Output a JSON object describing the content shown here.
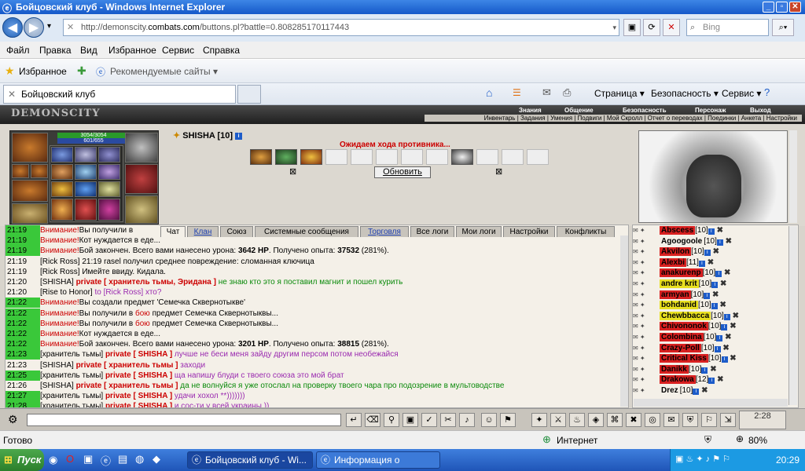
{
  "window": {
    "title": "Бойцовский клуб - Windows Internet Explorer"
  },
  "address": {
    "url_pre": "http://demonscity.",
    "url_dom": "combats.com",
    "url_post": "/buttons.pl?battle=0.808285170117443",
    "search_placeholder": "Bing"
  },
  "menu": [
    "Файл",
    "Правка",
    "Вид",
    "Избранное",
    "Сервис",
    "Справка"
  ],
  "favbar": {
    "favorites": "Избранное",
    "suggested": "Рекомендуемые сайты ▾"
  },
  "tab": {
    "title": "Бойцовский клуб"
  },
  "cmdbar": {
    "page": "Страница ▾",
    "safety": "Безопасность ▾",
    "tools": "Сервис ▾"
  },
  "game": {
    "logo": "DEMONSCITY",
    "topmenu": [
      "Знания",
      "Общение",
      "Безопасность",
      "Персонаж",
      "Выход"
    ],
    "submenu": "Инвентарь | Задания | Умения | Подвиги | Мой Скролл | Отчет о переводах | Поединки | Анкета | Настройки",
    "hp": "3054/3054",
    "mp": "601/655",
    "player": "SHISHA [10]",
    "waiting": "Ожидаем хода противника...",
    "refresh": "Обновить",
    "chat_tabs": [
      "Чат",
      "Клан",
      "Союз",
      "Системные сообщения",
      "Торговля",
      "Все логи",
      "Мои логи",
      "Настройки",
      "Конфликты"
    ],
    "chat": [
      {
        "t": "21:19",
        "g": true,
        "parts": [
          [
            "warn",
            "Внимание!"
          ],
          [
            "",
            "Вы получили в"
          ]
        ]
      },
      {
        "t": "21:19",
        "g": true,
        "parts": [
          [
            "warn",
            "Внимание!"
          ],
          [
            "",
            "Кот нуждается в еде..."
          ]
        ]
      },
      {
        "t": "21:19",
        "g": true,
        "parts": [
          [
            "warn",
            "Внимание!"
          ],
          [
            "",
            "Бой закончен. Всего вами нанесено урона: "
          ],
          [
            "b",
            "3642 HP"
          ],
          [
            "",
            ". Получено опыта: "
          ],
          [
            "b",
            "37532"
          ],
          [
            "",
            " (281%)."
          ]
        ]
      },
      {
        "t": "21:19",
        "g": false,
        "parts": [
          [
            "nick",
            "[Rick Ross]"
          ],
          [
            "",
            " 21:19 rasel получил среднее повреждение: сломанная ключица"
          ]
        ]
      },
      {
        "t": "21:19",
        "g": false,
        "parts": [
          [
            "nick",
            "[Rick Ross]"
          ],
          [
            "",
            " Имейте ввиду. Кидала."
          ]
        ]
      },
      {
        "t": "21:20",
        "g": false,
        "parts": [
          [
            "nick",
            "[SHISHA]"
          ],
          [
            "priv",
            " private [ хранитель тьмы, Эридана ]"
          ],
          [
            "gm",
            " не знаю кто это я поставил магнит и пошел курить"
          ]
        ]
      },
      {
        "t": "21:20",
        "g": false,
        "parts": [
          [
            "nick",
            "[Rise to Honor]"
          ],
          [
            "pm",
            " to [Rick Ross] хто?"
          ]
        ]
      },
      {
        "t": "21:22",
        "g": true,
        "parts": [
          [
            "warn",
            "Внимание!"
          ],
          [
            "",
            "Вы создали предмет 'Семечка Сквернотыкве'"
          ]
        ]
      },
      {
        "t": "21:22",
        "g": true,
        "parts": [
          [
            "warn",
            "Внимание!"
          ],
          [
            "",
            "Вы получили в "
          ],
          [
            "warn",
            "бою"
          ],
          [
            "",
            " предмет Семечка Сквернотыквы..."
          ]
        ]
      },
      {
        "t": "21:22",
        "g": true,
        "parts": [
          [
            "warn",
            "Внимание!"
          ],
          [
            "",
            "Вы получили в "
          ],
          [
            "warn",
            "бою"
          ],
          [
            "",
            " предмет Семечка Сквернотыквы..."
          ]
        ]
      },
      {
        "t": "21:22",
        "g": true,
        "parts": [
          [
            "warn",
            "Внимание!"
          ],
          [
            "",
            "Кот нуждается в еде..."
          ]
        ]
      },
      {
        "t": "21:22",
        "g": true,
        "parts": [
          [
            "warn",
            "Внимание!"
          ],
          [
            "",
            "Бой закончен. Всего вами нанесено урона: "
          ],
          [
            "b",
            "3201 HP"
          ],
          [
            "",
            ". Получено опыта: "
          ],
          [
            "b",
            "38815"
          ],
          [
            "",
            " (281%)."
          ]
        ]
      },
      {
        "t": "21:23",
        "g": true,
        "parts": [
          [
            "nick",
            "[хранитель тьмы]"
          ],
          [
            "priv",
            " private [ SHISHA ]"
          ],
          [
            "pm",
            " лучше не беси меня зайду другим персом потом необежайся"
          ]
        ]
      },
      {
        "t": "21:23",
        "g": false,
        "parts": [
          [
            "nick",
            "[SHISHA]"
          ],
          [
            "priv",
            " private [ хранитель тьмы ]"
          ],
          [
            "pm",
            " заходи"
          ]
        ]
      },
      {
        "t": "21:25",
        "g": true,
        "parts": [
          [
            "nick",
            "[хранитель тьмы]"
          ],
          [
            "priv",
            " private [ SHISHA ]"
          ],
          [
            "pm",
            " ща напишу блуди с твоего союза это мой брат"
          ]
        ]
      },
      {
        "t": "21:26",
        "g": false,
        "parts": [
          [
            "nick",
            "[SHISHA]"
          ],
          [
            "priv",
            " private [ хранитель тьмы ]"
          ],
          [
            "gm",
            " да не волнуйся я уже отослал на проверку твоего чара про подозрение в мультоводстве"
          ]
        ]
      },
      {
        "t": "21:27",
        "g": true,
        "parts": [
          [
            "nick",
            "[хранитель тьмы]"
          ],
          [
            "priv",
            " private [ SHISHA ]"
          ],
          [
            "pm",
            " удачи хохол **)))))))"
          ]
        ]
      },
      {
        "t": "21:28",
        "g": true,
        "parts": [
          [
            "nick",
            "[хранитель тьмы]"
          ],
          [
            "priv",
            " private [ SHISHA ]"
          ],
          [
            "pm",
            " и сос-ти у всей украины ))"
          ]
        ]
      }
    ],
    "users": [
      {
        "n": "Abscess",
        "l": "[10]",
        "c": "red"
      },
      {
        "n": "Agoogoole",
        "l": "[10]",
        "c": ""
      },
      {
        "n": "Akvilon",
        "l": "[10]",
        "c": "red"
      },
      {
        "n": "Alexbi",
        "l": "[11]",
        "c": "red"
      },
      {
        "n": "anakurenp",
        "l": "[10]",
        "c": "red"
      },
      {
        "n": "andre krit",
        "l": "[10]",
        "c": "yel"
      },
      {
        "n": "armyan",
        "l": "[10]",
        "c": "red"
      },
      {
        "n": "bohdanid",
        "l": "[10]",
        "c": "yel"
      },
      {
        "n": "Chewbbacca",
        "l": "[10]",
        "c": "yel"
      },
      {
        "n": "Chivononok",
        "l": "[10]",
        "c": "red"
      },
      {
        "n": "Colombina",
        "l": "[10]",
        "c": "red"
      },
      {
        "n": "Crazy-Poll",
        "l": "[10]",
        "c": "red"
      },
      {
        "n": "Critical Kiss",
        "l": "[10]",
        "c": "red"
      },
      {
        "n": "Danikk",
        "l": "[10]",
        "c": "red"
      },
      {
        "n": "Drakowa",
        "l": "[12]",
        "c": "red"
      },
      {
        "n": "Drez",
        "l": "[10]",
        "c": ""
      }
    ],
    "clock": "2:28"
  },
  "status": {
    "ready": "Готово",
    "zone": "Интернет",
    "zoom": "80%"
  },
  "taskbar": {
    "start": "Пуск",
    "task1": "Бойцовский клуб - Wi...",
    "task2": "Информация о хранителе...",
    "time": "20:29"
  }
}
